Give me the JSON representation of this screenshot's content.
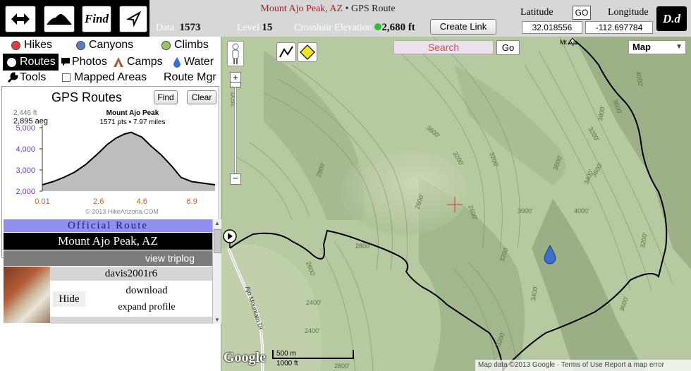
{
  "topbar": {
    "arrows_icon": "left-right-arrows-icon",
    "mountain_icon": "mountain-icon",
    "find_label": "Find",
    "locate_icon": "navigation-arrow-icon",
    "title_peak": "Mount Ajo Peak, AZ",
    "title_rest": " • GPS Route",
    "data_label": "Data",
    "data_value": "1573",
    "level_label": "Level",
    "level_value": "15",
    "crosshair_label": "Crosshair Elevation",
    "crosshair_value": "2,680 ft",
    "create_link_label": "Create Link",
    "latitude_label": "Latitude",
    "go_label": "GO",
    "longitude_label": "Longitude",
    "latitude_value": "32.018556",
    "longitude_value": "-112.697784",
    "dd_label": "D.d"
  },
  "sidebar": {
    "nav": {
      "hikes": "Hikes",
      "canyons": "Canyons",
      "climbs": "Climbs",
      "routes": "Routes",
      "photos": "Photos",
      "camps": "Camps",
      "water": "Water",
      "tools": "Tools",
      "mapped_areas": "Mapped Areas",
      "route_mgr": "Route Mgr"
    },
    "colors": {
      "hikes": "#e63c3c",
      "canyons": "#5a79c8",
      "climbs": "#9bc46a",
      "water": "#3b6fd0",
      "camps": "#a0613a"
    },
    "gps": {
      "title": "GPS Routes",
      "find_label": "Find",
      "clear_label": "Clear"
    },
    "profile": {
      "cursor_elev": "2,446 ft",
      "aeg": "2,895 aeg",
      "route_name": "Mount Ajo Peak",
      "stats": "1571 pts • 7.97 miles",
      "copyright": "© 2013 HikeArizona.COM",
      "y_ticks": [
        "5,000",
        "4,000",
        "3,000",
        "2,000"
      ],
      "x_ticks": [
        "0.01",
        "2.6",
        "4.6",
        "6.9"
      ]
    },
    "official": {
      "banner": "Official Route",
      "name": "Mount Ajo Peak, AZ",
      "view_triplog": "view triplog",
      "user": "davis2001r6",
      "hide_label": "Hide",
      "download_label": "download",
      "expand_label": "expand profile"
    }
  },
  "map": {
    "search_placeholder": "Search",
    "go_label": "Go",
    "map_type": "Map",
    "google_logo": "Google",
    "scale_m": "500 m",
    "scale_ft": "1000 ft",
    "attribution": "Map data ©2013 Google · Terms of Use  Report a map error",
    "contours": [
      "4000'",
      "3600'",
      "3200'",
      "3600'",
      "3200'",
      "2800'",
      "3200'",
      "3600'",
      "4000'",
      "3400'",
      "3800'",
      "3000'",
      "2600'",
      "2600'",
      "2400'",
      "3200'",
      "3400'",
      "2800'",
      "2600'",
      "2800'",
      "3200'",
      "3600'",
      "2400'",
      "3200'",
      "3600'",
      "2600'"
    ],
    "road_label": "Ajo Mountain Dr",
    "peak_label": "Mt Ajo"
  },
  "chart_data": {
    "type": "area",
    "title": "Mount Ajo Peak",
    "subtitle": "1571 pts • 7.97 miles",
    "xlabel": "",
    "ylabel": "",
    "x": [
      0.01,
      0.5,
      1.0,
      1.5,
      2.0,
      2.6,
      3.0,
      3.4,
      3.8,
      4.1,
      4.6,
      5.0,
      5.5,
      6.0,
      6.4,
      6.9,
      7.97
    ],
    "values": [
      2300,
      2450,
      2650,
      2900,
      3250,
      3800,
      4200,
      4500,
      4700,
      4780,
      4550,
      4150,
      3700,
      3150,
      2650,
      2450,
      2300
    ],
    "xlim": [
      0.01,
      7.97
    ],
    "ylim": [
      2000,
      5000
    ],
    "x_ticks": [
      0.01,
      2.6,
      4.6,
      6.9
    ],
    "y_ticks": [
      2000,
      3000,
      4000,
      5000
    ],
    "grid": false
  }
}
